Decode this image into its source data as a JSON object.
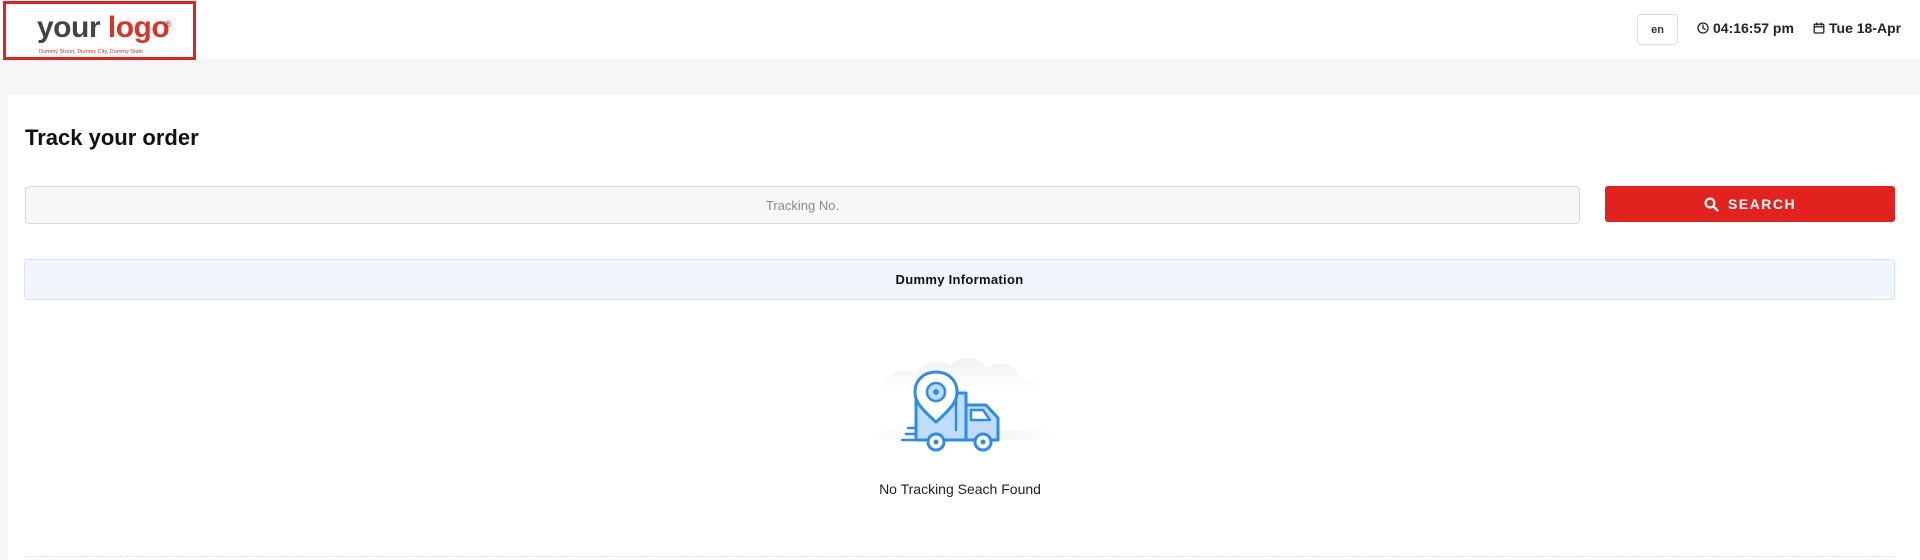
{
  "header": {
    "logo": {
      "word1": "your",
      "word2": "logo",
      "registered": "®",
      "tagline": "Dummy Street, Dummy City, Dummy State"
    },
    "language": "en",
    "time": "04:16:57 pm",
    "date": "Tue 18-Apr",
    "icons": {
      "clock": "clock-icon",
      "calendar": "calendar-icon"
    }
  },
  "main": {
    "title": "Track your order",
    "tracking_input": {
      "placeholder": "Tracking No.",
      "value": ""
    },
    "search_button": {
      "label": "SEARCH",
      "icon": "search-icon"
    },
    "info_bar": "Dummy Information",
    "empty_state": {
      "illustration": "delivery-truck-illustration",
      "message": "No Tracking Seach Found"
    }
  },
  "colors": {
    "accent": "#e2221f",
    "info_bg": "#f1f6fd",
    "illustration_blue": "#2f8be6",
    "illustration_fill": "#bfdcfb"
  }
}
